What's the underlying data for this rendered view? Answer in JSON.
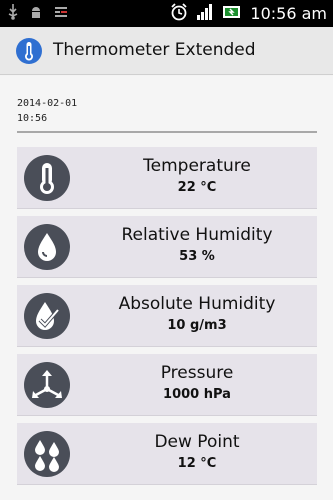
{
  "status_bar": {
    "time": "10:56 am",
    "icons": [
      "usb-icon",
      "android-debug-icon",
      "notification-icon",
      "alarm-icon",
      "signal-icon",
      "battery-icon"
    ]
  },
  "app": {
    "title": "Thermometer Extended",
    "icon": "thermometer-icon"
  },
  "reading": {
    "date": "2014-02-01",
    "time": "10:56"
  },
  "measurements": [
    {
      "label": "Temperature",
      "value": "22 °C",
      "icon": "thermometer-icon"
    },
    {
      "label": "Relative Humidity",
      "value": "53 %",
      "icon": "drop-icon"
    },
    {
      "label": "Absolute Humidity",
      "value": "10 g/m3",
      "icon": "drop-check-icon"
    },
    {
      "label": "Pressure",
      "value": "1000 hPa",
      "icon": "pressure-arrows-icon"
    },
    {
      "label": "Dew Point",
      "value": "12 °C",
      "icon": "dew-drops-icon"
    }
  ],
  "colors": {
    "status_bar": "#000000",
    "action_bar": "#e8e8e8",
    "card": "#e6e3ea",
    "icon_circle": "#4a4e58",
    "app_icon": "#2f6fd1"
  }
}
